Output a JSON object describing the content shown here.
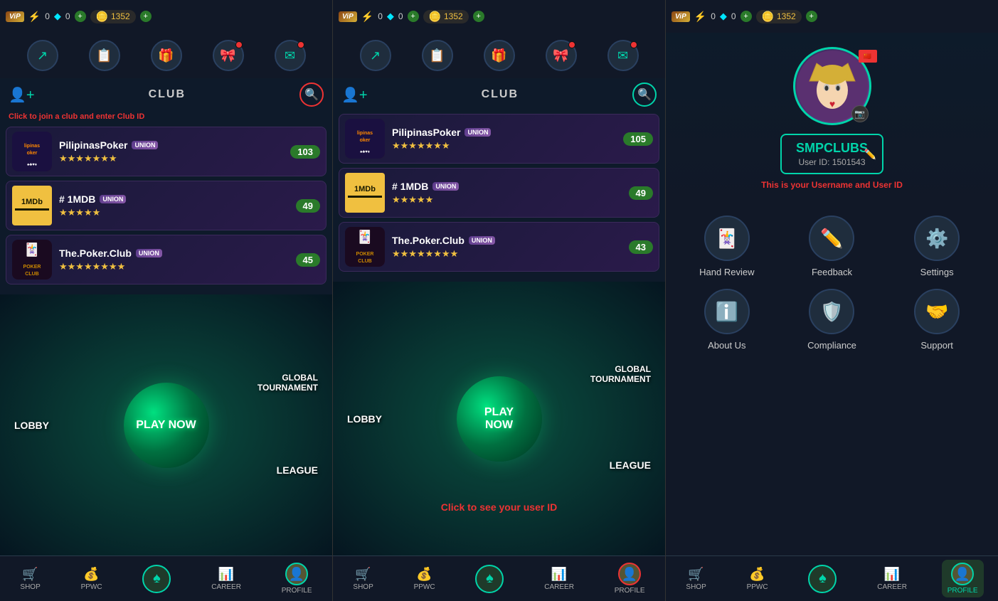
{
  "panels": [
    {
      "id": "panel1",
      "topbar": {
        "vip_label": "ViP",
        "bolt_val": "0",
        "gem_val": "0",
        "coin_val": "1352"
      },
      "icons": [
        "share",
        "news",
        "gift",
        "gift2",
        "mail"
      ],
      "club_section": {
        "title": "CLUB",
        "hint": "Click to join a club and enter Club ID",
        "search_highlighted": true,
        "clubs": [
          {
            "name": "PilipinasPoker",
            "stars": 7,
            "count": "103",
            "logo_type": "pp"
          },
          {
            "name": "# 1MDB",
            "stars": 5,
            "count": "49",
            "logo_type": "imdb"
          },
          {
            "name": "The.Poker.Club",
            "stars": 8,
            "count": "45",
            "logo_type": "poker"
          }
        ]
      },
      "game": {
        "lobby": "LOBBY",
        "play_now": "PLAY NOW",
        "global": "GLOBAL\nTOURNAMENT",
        "league": "LEAGUE"
      },
      "navbar": {
        "items": [
          "SHOP",
          "PPWC",
          "",
          "CAREER",
          "PROFILE"
        ],
        "active": "spade"
      }
    },
    {
      "id": "panel2",
      "topbar": {
        "vip_label": "ViP",
        "bolt_val": "0",
        "gem_val": "0",
        "coin_val": "1352"
      },
      "icons": [
        "share",
        "news",
        "gift",
        "gift2",
        "mail"
      ],
      "club_section": {
        "title": "CLUB",
        "hint": "",
        "search_highlighted": false,
        "clubs": [
          {
            "name": "PilipinasPoker",
            "stars": 7,
            "count": "105",
            "logo_type": "pp"
          },
          {
            "name": "# 1MDB",
            "stars": 5,
            "count": "49",
            "logo_type": "imdb"
          },
          {
            "name": "The.Poker.Club",
            "stars": 8,
            "count": "43",
            "logo_type": "poker"
          }
        ]
      },
      "game": {
        "lobby": "LOBBY",
        "play_now": "PLAY\nNOW",
        "global": "GLOBAL\nTOURNAMENT",
        "league": "LEAGUE",
        "hint": "Click to see your user ID"
      },
      "navbar": {
        "items": [
          "SHOP",
          "PPWC",
          "",
          "CAREER",
          "PROFILE"
        ],
        "active": "spade",
        "profile_highlighted": true
      }
    }
  ],
  "profile_panel": {
    "topbar": {
      "vip_label": "ViP",
      "bolt_val": "0",
      "gem_val": "0",
      "coin_val": "1352"
    },
    "username": "SMPCLUBS",
    "user_id_label": "User ID: 1501543",
    "hint": "This is your Username and User ID",
    "actions": [
      {
        "id": "hand-review",
        "label": "Hand Review",
        "icon": "🃏"
      },
      {
        "id": "feedback",
        "label": "Feedback",
        "icon": "✏️"
      },
      {
        "id": "settings",
        "label": "Settings",
        "icon": "⚙️"
      },
      {
        "id": "about-us",
        "label": "About Us",
        "icon": "ℹ️"
      },
      {
        "id": "compliance",
        "label": "Compliance",
        "icon": "🛡️"
      },
      {
        "id": "support",
        "label": "Support",
        "icon": "🤝"
      }
    ],
    "navbar": {
      "items": [
        "SHOP",
        "PPWC",
        "",
        "CAREER",
        "PROFILE"
      ],
      "active": "profile"
    }
  },
  "stars_char": "★",
  "share_icon": "↗",
  "news_icon": "📋",
  "gift_icon": "🎁",
  "mail_icon": "✉"
}
